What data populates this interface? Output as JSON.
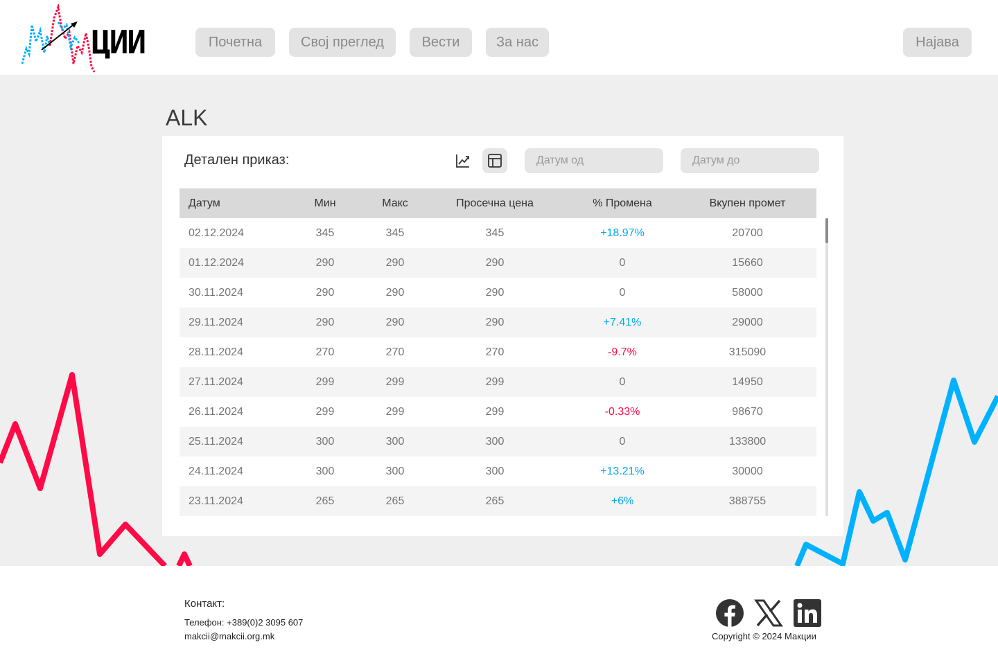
{
  "brand": {
    "logo_text": "ЦИИ"
  },
  "nav": {
    "items": [
      "Почетна",
      "Свој преглед",
      "Вести",
      "За нас"
    ],
    "login": "Најава"
  },
  "page": {
    "title": "ALK"
  },
  "detail": {
    "label": "Детален приказ:",
    "view_modes": [
      {
        "icon": "line-chart-icon",
        "active": false
      },
      {
        "icon": "table-grid-icon",
        "active": true
      }
    ],
    "date_from_placeholder": "Датум од",
    "date_to_placeholder": "Датум до"
  },
  "table": {
    "headers": [
      "Датум",
      "Мин",
      "Макс",
      "Просечна цена",
      "% Промена",
      "Вкупен промет"
    ],
    "rows": [
      [
        "02.12.2024",
        "345",
        "345",
        "345",
        "+18.97%",
        "20700"
      ],
      [
        "01.12.2024",
        "290",
        "290",
        "290",
        "0",
        "15660"
      ],
      [
        "30.11.2024",
        "290",
        "290",
        "290",
        "0",
        "58000"
      ],
      [
        "29.11.2024",
        "290",
        "290",
        "290",
        "+7.41%",
        "29000"
      ],
      [
        "28.11.2024",
        "270",
        "270",
        "270",
        "-9.7%",
        "315090"
      ],
      [
        "27.11.2024",
        "299",
        "299",
        "299",
        "0",
        "14950"
      ],
      [
        "26.11.2024",
        "299",
        "299",
        "299",
        "-0.33%",
        "98670"
      ],
      [
        "25.11.2024",
        "300",
        "300",
        "300",
        "0",
        "133800"
      ],
      [
        "24.11.2024",
        "300",
        "300",
        "300",
        "+13.21%",
        "30000"
      ],
      [
        "23.11.2024",
        "265",
        "265",
        "265",
        "+6%",
        "388755"
      ]
    ]
  },
  "footer": {
    "contact_title": "Контакт:",
    "phone": "Телефон: +389(0)2 3095 607",
    "email": "makcii@makcii.org.mk",
    "social": [
      "facebook-icon",
      "x-icon",
      "linkedin-icon"
    ],
    "copyright": "Copyright © 2024 Макции"
  },
  "colors": {
    "positive": "#00a9ef",
    "negative": "#ff0a46",
    "button_bg": "#e3e3e3",
    "page_bg": "#efefef"
  }
}
